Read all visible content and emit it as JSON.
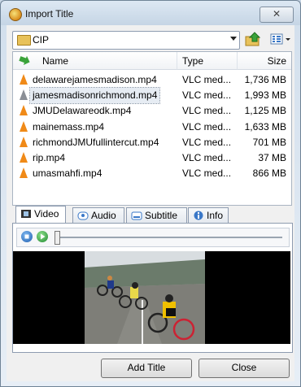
{
  "window": {
    "title": "Import Title",
    "close_glyph": "✕"
  },
  "folder": {
    "current": "CIP"
  },
  "columns": {
    "name": "Name",
    "type": "Type",
    "size": "Size"
  },
  "files": [
    {
      "name": "delawarejamesmadison.mp4",
      "type": "VLC med...",
      "size": "1,736 MB",
      "icon": "vlc-cone-icon"
    },
    {
      "name": "jamesmadisonrichmond.mp4",
      "type": "VLC med...",
      "size": "1,993 MB",
      "icon": "vlc-cone-gray-icon",
      "selected": true
    },
    {
      "name": "JMUDelawareodk.mp4",
      "type": "VLC med...",
      "size": "1,125 MB",
      "icon": "vlc-cone-icon"
    },
    {
      "name": "mainemass.mp4",
      "type": "VLC med...",
      "size": "1,633 MB",
      "icon": "vlc-cone-icon"
    },
    {
      "name": "richmondJMUfullintercut.mp4",
      "type": "VLC med...",
      "size": "701 MB",
      "icon": "vlc-cone-icon"
    },
    {
      "name": "rip.mp4",
      "type": "VLC med...",
      "size": "37 MB",
      "icon": "vlc-cone-icon"
    },
    {
      "name": "umasmahfi.mp4",
      "type": "VLC med...",
      "size": "866 MB",
      "icon": "vlc-cone-icon"
    }
  ],
  "tabs": [
    {
      "label": "Video",
      "icon": "film-icon",
      "active": true
    },
    {
      "label": "Audio",
      "icon": "speaker-icon"
    },
    {
      "label": "Subtitle",
      "icon": "subtitle-icon"
    },
    {
      "label": "Info",
      "icon": "info-icon"
    }
  ],
  "player": {
    "seek_fraction": 0.0
  },
  "buttons": {
    "add_title": "Add Title",
    "close": "Close"
  },
  "colors": {
    "accent": "#3a78c8",
    "vlc_orange": "#f08a18"
  }
}
